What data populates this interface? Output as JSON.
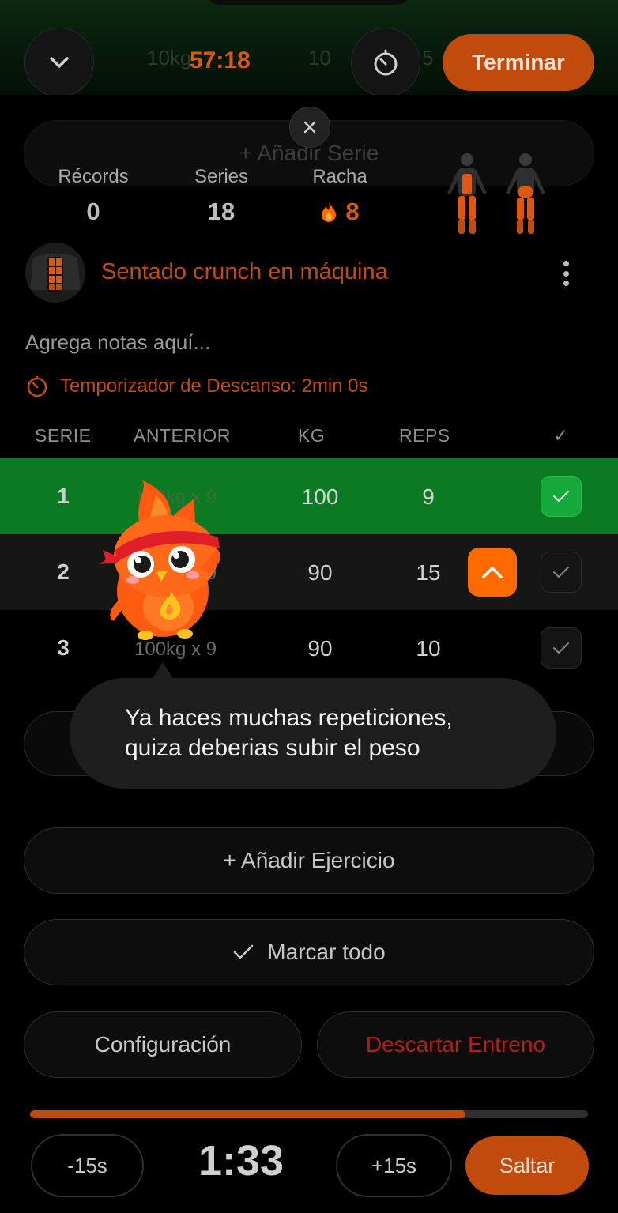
{
  "header": {
    "timer": "57:18",
    "finish_label": "Terminar",
    "ghost_weight": "10kg",
    "ghost_reps": "10",
    "ghost_digit": "5"
  },
  "behind": {
    "add_set_label": "+ Añadir Serie"
  },
  "stats": {
    "records_label": "Récords",
    "records_value": "0",
    "series_label": "Series",
    "series_value": "18",
    "streak_label": "Racha",
    "streak_value": "8"
  },
  "exercise": {
    "name": "Sentado crunch en máquina",
    "notes_placeholder": "Agrega notas aquí...",
    "rest_timer": "Temporizador de Descanso: 2min 0s"
  },
  "table": {
    "headers": {
      "set": "SERIE",
      "previous": "ANTERIOR",
      "kg": "KG",
      "reps": "REPS",
      "done": "✓"
    },
    "rows": [
      {
        "set": "1",
        "previous": "100kg x 9",
        "kg": "100",
        "reps": "9",
        "done": true
      },
      {
        "set": "2",
        "previous": "100kg x 9",
        "kg": "90",
        "reps": "15",
        "done": false
      },
      {
        "set": "3",
        "previous": "100kg x 9",
        "kg": "90",
        "reps": "10",
        "done": false
      }
    ]
  },
  "tooltip": {
    "line1": "Ya haces muchas repeticiones,",
    "line2": "quiza deberias subir el peso"
  },
  "actions": {
    "add_exercise": "+ Añadir Ejercicio",
    "mark_all": "Marcar todo",
    "settings": "Configuración",
    "discard": "Descartar Entreno"
  },
  "rest_bar": {
    "minus_label": "-15s",
    "time": "1:33",
    "plus_label": "+15s",
    "skip_label": "Saltar",
    "progress": 0.78
  },
  "colors": {
    "accent": "#c14a0d",
    "done_green": "#0b7a23",
    "danger": "#b3201a"
  }
}
